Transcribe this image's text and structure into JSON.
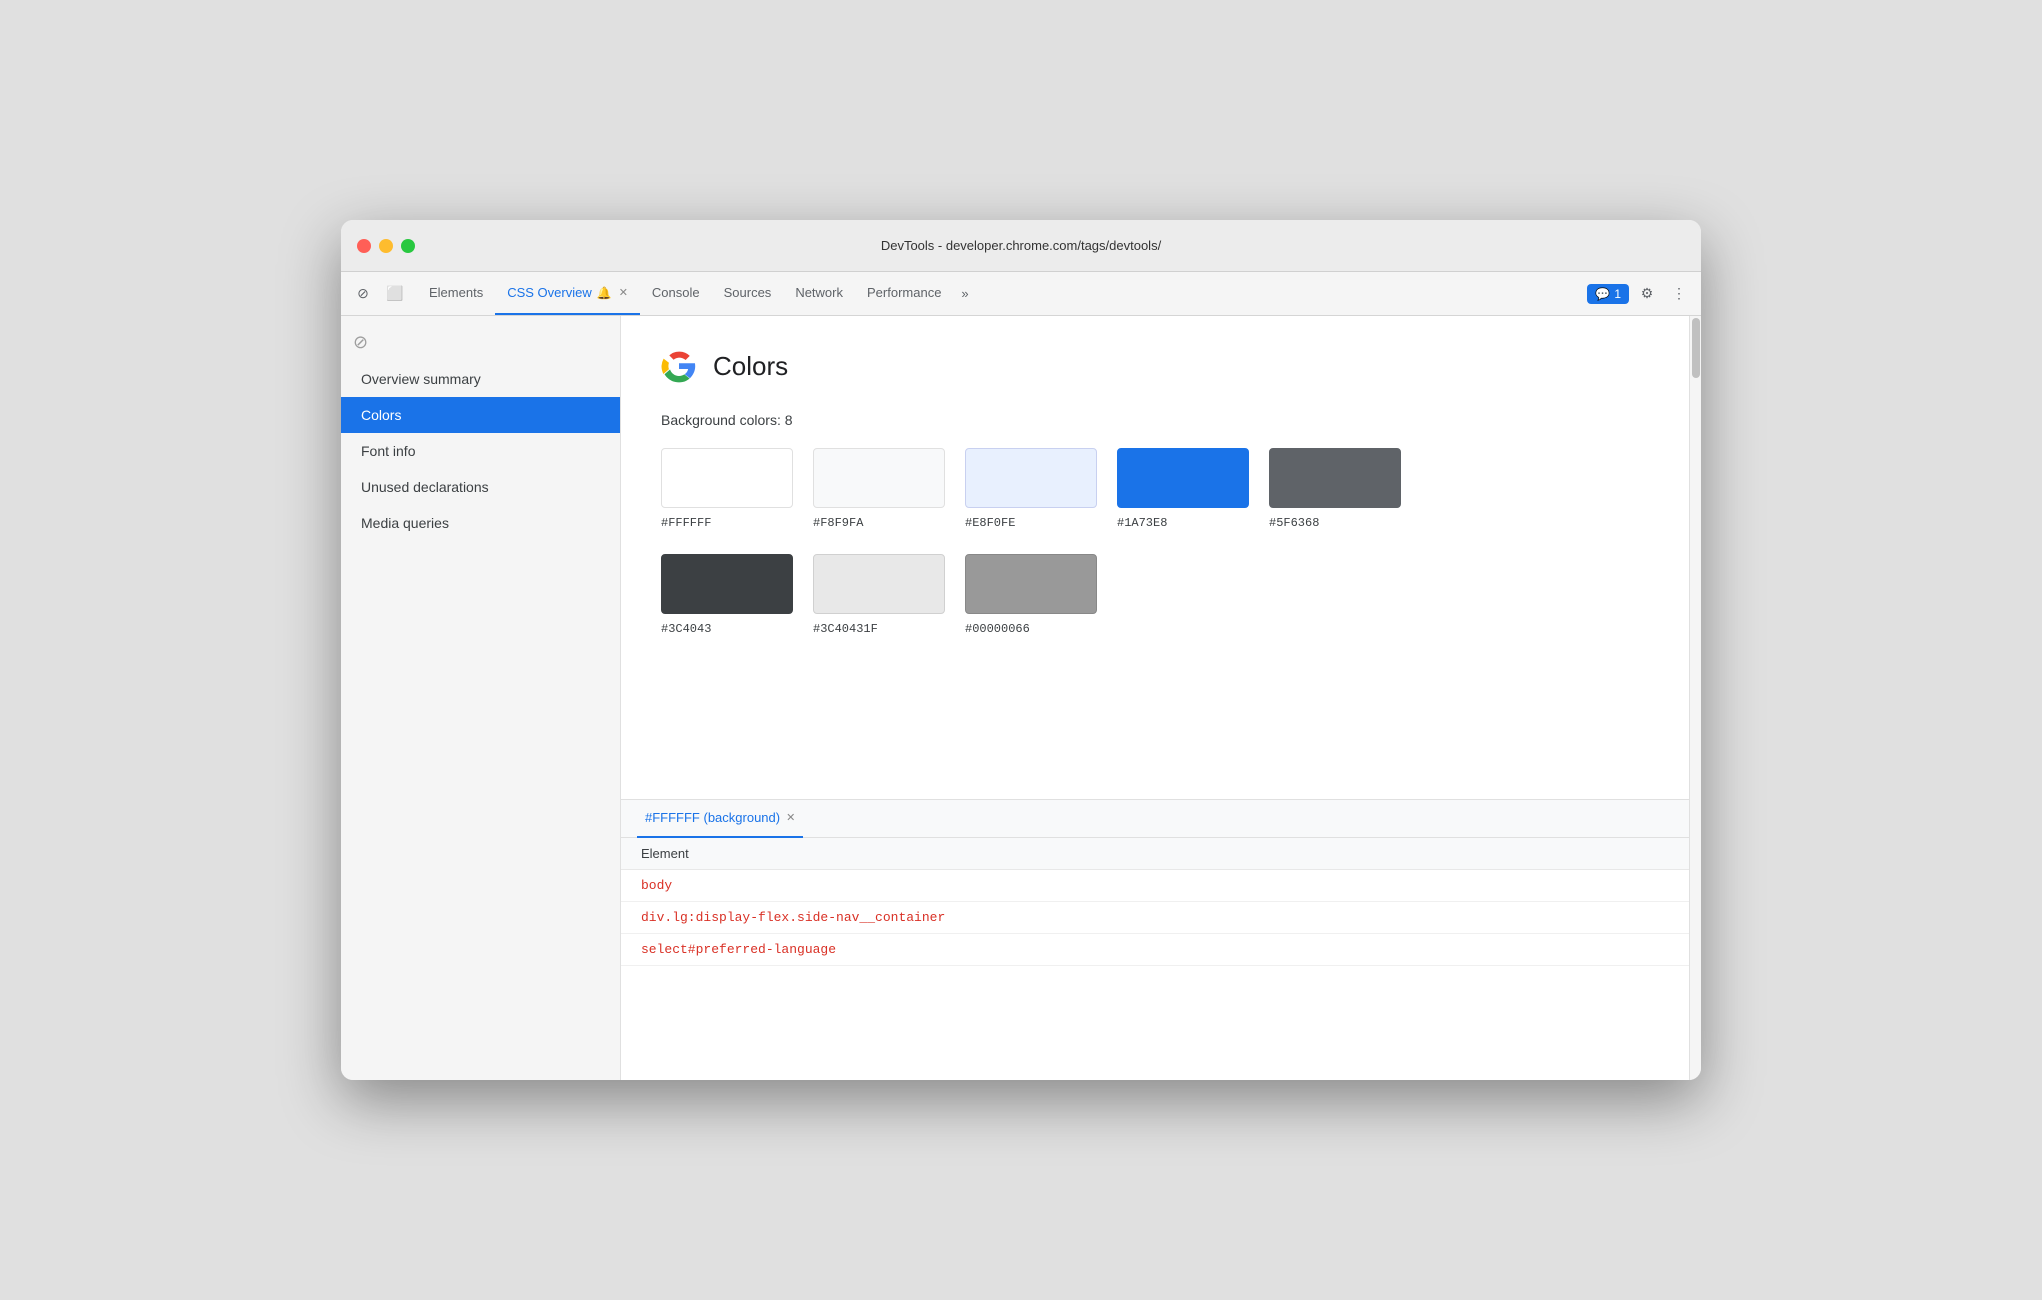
{
  "window": {
    "title": "DevTools - developer.chrome.com/tags/devtools/"
  },
  "tabs": [
    {
      "id": "elements",
      "label": "Elements",
      "active": false,
      "closeable": false
    },
    {
      "id": "css-overview",
      "label": "CSS Overview",
      "active": true,
      "closeable": true,
      "has_icon": true
    },
    {
      "id": "console",
      "label": "Console",
      "active": false,
      "closeable": false
    },
    {
      "id": "sources",
      "label": "Sources",
      "active": false,
      "closeable": false
    },
    {
      "id": "network",
      "label": "Network",
      "active": false,
      "closeable": false
    },
    {
      "id": "performance",
      "label": "Performance",
      "active": false,
      "closeable": false
    }
  ],
  "tab_more": "»",
  "badge": {
    "icon": "💬",
    "count": "1"
  },
  "sidebar": {
    "items": [
      {
        "id": "overview-summary",
        "label": "Overview summary",
        "active": false
      },
      {
        "id": "colors",
        "label": "Colors",
        "active": true
      },
      {
        "id": "font-info",
        "label": "Font info",
        "active": false
      },
      {
        "id": "unused-declarations",
        "label": "Unused declarations",
        "active": false
      },
      {
        "id": "media-queries",
        "label": "Media queries",
        "active": false
      }
    ]
  },
  "colors_panel": {
    "title": "Colors",
    "bg_colors_label": "Background colors: 8",
    "swatches": [
      [
        {
          "id": "ffffff",
          "hex": "#FFFFFF",
          "color": "#FFFFFF",
          "border": "#e0e0e0"
        },
        {
          "id": "f8f9fa",
          "hex": "#F8F9FA",
          "color": "#F8F9FA",
          "border": "#e0e0e0"
        },
        {
          "id": "e8f0fe",
          "hex": "#E8F0FE",
          "color": "#E8F0FE",
          "border": "#d0d8f0"
        },
        {
          "id": "1a73e8",
          "hex": "#1A73E8",
          "color": "#1A73E8",
          "border": "#1a73e8"
        },
        {
          "id": "5f6368",
          "hex": "#5F6368",
          "color": "#5F6368",
          "border": "#5f6368"
        }
      ],
      [
        {
          "id": "3c4043",
          "hex": "#3C4043",
          "color": "#3C4043",
          "border": "#3c4043"
        },
        {
          "id": "3c40431f",
          "hex": "#3C40431F",
          "color": "#e8e8e8",
          "border": "#d0d0d0"
        },
        {
          "id": "00000066",
          "hex": "#00000066",
          "color": "#9e9e9e",
          "border": "#9e9e9e"
        }
      ]
    ]
  },
  "bottom_panel": {
    "tab_label": "#FFFFFF (background)",
    "element_header": "Element",
    "elements": [
      {
        "id": "body",
        "text": "body"
      },
      {
        "id": "div-lg",
        "text": "div.lg:display-flex.side-nav__container"
      },
      {
        "id": "select-preferred",
        "text": "select#preferred-language"
      }
    ]
  }
}
